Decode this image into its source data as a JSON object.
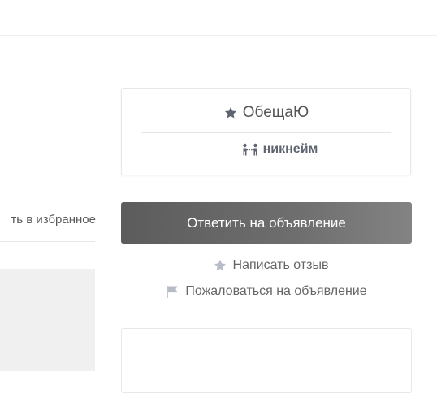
{
  "favorites": {
    "label": "ть в избранное"
  },
  "profile": {
    "name": "ОбещаЮ",
    "nickname": "никнейм",
    "name_icon": "star-icon",
    "nickname_icon": "handshake-icon"
  },
  "actions": {
    "reply_label": "Ответить на объявление",
    "review_label": "Написать отзыв",
    "review_icon": "star-icon",
    "report_label": "Пожаловаться на объявление",
    "report_icon": "flag-icon"
  },
  "colors": {
    "button_gradient_start": "#5c5c5c",
    "button_gradient_end": "#838383",
    "icon_dark": "#5f6570",
    "icon_light": "#b7bcc6"
  }
}
